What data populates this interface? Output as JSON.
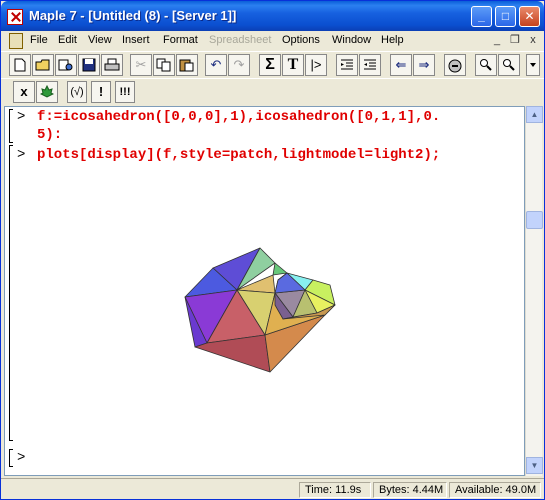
{
  "window": {
    "title": "Maple 7  - [Untitled (8) - [Server 1]]",
    "controls": {
      "minimize": "_",
      "maximize": "□",
      "close": "✕"
    }
  },
  "menu": {
    "items": [
      "File",
      "Edit",
      "View",
      "Insert",
      "Format",
      "Spreadsheet",
      "Options",
      "Window",
      "Help"
    ],
    "disabled": [
      "Spreadsheet"
    ],
    "mdi_controls": {
      "minimize": "_",
      "restore": "❐",
      "close": "x"
    }
  },
  "toolbar2": {
    "buttons": [
      "x",
      "maple-leaf",
      "(√)",
      "!",
      "!!!"
    ]
  },
  "worksheet": {
    "prompt_symbol": ">",
    "input1_line1": "f:=icosahedron([0,0,0],1),icosahedron([0,1,1],0.",
    "input1_line2": "5):",
    "input2": "plots[display](f,style=patch,lightmodel=light2);",
    "empty_prompt": ">"
  },
  "status": {
    "time": "Time: 11.9s",
    "bytes": "Bytes: 4.44M",
    "available": "Available: 49.0M"
  },
  "colors": {
    "input_text": "#e00000",
    "title_bar": "#0b4fd0",
    "window_face": "#ece9d8"
  }
}
